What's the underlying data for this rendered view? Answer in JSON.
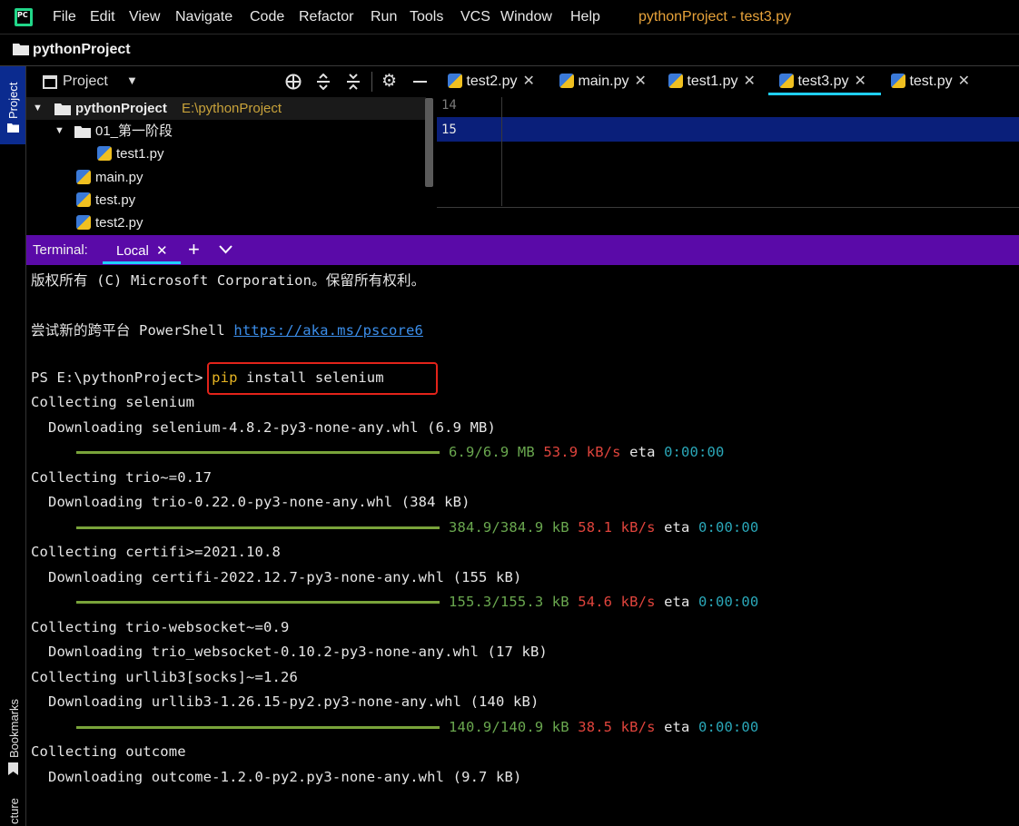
{
  "menubar": {
    "logo_text": "PC",
    "items": [
      "File",
      "Edit",
      "View",
      "Navigate",
      "Code",
      "Refactor",
      "Run",
      "Tools",
      "VCS",
      "Window",
      "Help"
    ],
    "window_title": "pythonProject - test3.py"
  },
  "navbar": {
    "project": "pythonProject"
  },
  "left_strip": {
    "project_label": "Project",
    "bookmarks_label": "Bookmarks",
    "structure_label": "cture"
  },
  "project_panel": {
    "title": "Project",
    "tree": [
      {
        "label": "pythonProject",
        "path": "E:\\pythonProject"
      },
      {
        "label": "01_第一阶段"
      },
      {
        "label": "test1.py"
      },
      {
        "label": "main.py"
      },
      {
        "label": "test.py"
      },
      {
        "label": "test2.py"
      }
    ]
  },
  "editor": {
    "tabs": [
      "test2.py",
      "main.py",
      "test1.py",
      "test3.py",
      "test.py"
    ],
    "active_tab": "test3.py",
    "line_numbers": [
      "14",
      "15"
    ]
  },
  "terminal": {
    "label": "Terminal:",
    "tab": "Local",
    "lines": {
      "copyright": "版权所有 (C) Microsoft Corporation。保留所有权利。",
      "try_prefix": "尝试新的跨平台 PowerShell ",
      "try_link": "https://aka.ms/pscore6",
      "prompt": "PS E:\\pythonProject> ",
      "cmd_pip": "pip",
      "cmd_rest": " install selenium",
      "c1": "Collecting selenium",
      "d1": "  Downloading selenium-4.8.2-py3-none-any.whl (6.9 MB)",
      "p1_size": "6.9/6.9 MB",
      "p1_speed": "53.9 kB/s",
      "p1_eta": "0:00:00",
      "c2": "Collecting trio~=0.17",
      "d2": "  Downloading trio-0.22.0-py3-none-any.whl (384 kB)",
      "p2_size": "384.9/384.9 kB",
      "p2_speed": "58.1 kB/s",
      "p2_eta": "0:00:00",
      "c3": "Collecting certifi>=2021.10.8",
      "d3": "  Downloading certifi-2022.12.7-py3-none-any.whl (155 kB)",
      "p3_size": "155.3/155.3 kB",
      "p3_speed": "54.6 kB/s",
      "p3_eta": "0:00:00",
      "c4": "Collecting trio-websocket~=0.9",
      "d4": "  Downloading trio_websocket-0.10.2-py3-none-any.whl (17 kB)",
      "c5": "Collecting urllib3[socks]~=1.26",
      "d5": "  Downloading urllib3-1.26.15-py2.py3-none-any.whl (140 kB)",
      "p5_size": "140.9/140.9 kB",
      "p5_speed": "38.5 kB/s",
      "p5_eta": "0:00:00",
      "c6": "Collecting outcome",
      "d6": "  Downloading outcome-1.2.0-py2.py3-none-any.whl (9.7 kB)",
      "eta_label": "eta"
    }
  },
  "colors": {
    "accent": "#1fd0ff",
    "terminal_header": "#5a0aa8",
    "highlight_box": "#e2231a",
    "progress": "#79a33a"
  }
}
